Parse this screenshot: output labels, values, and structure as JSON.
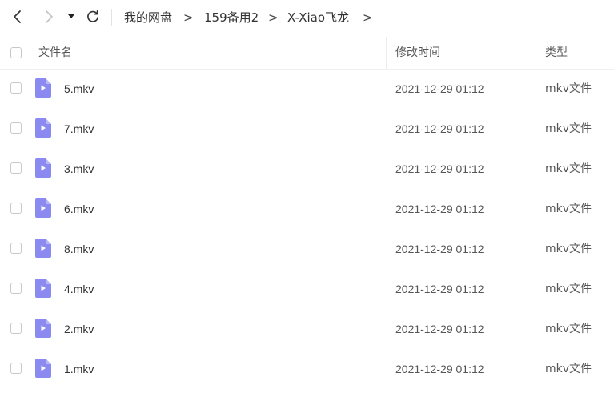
{
  "nav": {
    "back_icon": "chevron-left-icon",
    "forward_icon": "chevron-right-icon",
    "history_icon": "caret-down-icon",
    "refresh_icon": "refresh-icon",
    "breadcrumb": [
      "我的网盘",
      "159备用2",
      "X-Xiao飞龙"
    ],
    "separator": ">"
  },
  "table": {
    "headers": {
      "name": "文件名",
      "modified": "修改时间",
      "type": "类型"
    },
    "rows": [
      {
        "name": "5.mkv",
        "modified": "2021-12-29 01:12",
        "type": "mkv文件"
      },
      {
        "name": "7.mkv",
        "modified": "2021-12-29 01:12",
        "type": "mkv文件"
      },
      {
        "name": "3.mkv",
        "modified": "2021-12-29 01:12",
        "type": "mkv文件"
      },
      {
        "name": "6.mkv",
        "modified": "2021-12-29 01:12",
        "type": "mkv文件"
      },
      {
        "name": "8.mkv",
        "modified": "2021-12-29 01:12",
        "type": "mkv文件"
      },
      {
        "name": "4.mkv",
        "modified": "2021-12-29 01:12",
        "type": "mkv文件"
      },
      {
        "name": "2.mkv",
        "modified": "2021-12-29 01:12",
        "type": "mkv文件"
      },
      {
        "name": "1.mkv",
        "modified": "2021-12-29 01:12",
        "type": "mkv文件"
      }
    ]
  },
  "colors": {
    "video_icon": "#8a8af0",
    "video_icon_fold": "#b9b9f7",
    "text": "#333333",
    "muted_text": "#555555",
    "border": "#c8c8c8"
  }
}
